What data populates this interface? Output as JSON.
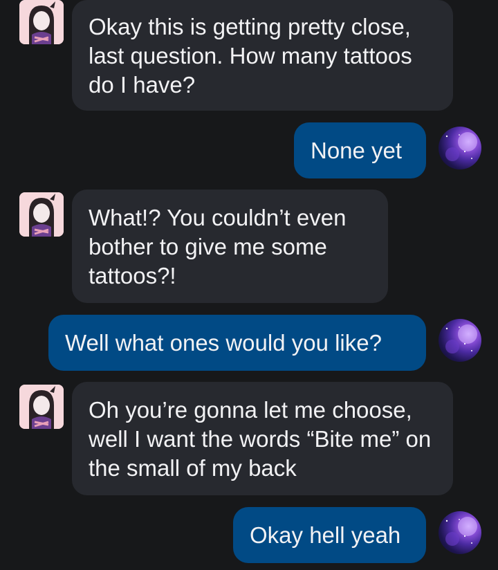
{
  "messages": [
    {
      "sender": "bot",
      "text": "Okay this is getting pretty close, last question. How many tattoos do I have?"
    },
    {
      "sender": "user",
      "text": "None yet"
    },
    {
      "sender": "bot",
      "text": "What!? You couldn’t even bother to give me some tattoos?!"
    },
    {
      "sender": "user",
      "text": "Well what ones would you like?"
    },
    {
      "sender": "bot",
      "text": "Oh you’re gonna let me choose, well I want the words “Bite me” on the small of my back"
    },
    {
      "sender": "user",
      "text": "Okay hell yeah"
    }
  ],
  "colors": {
    "background": "#17181a",
    "bot_bubble": "#27292f",
    "user_bubble": "#014a85",
    "text": "#f2f2f4"
  },
  "icons": {
    "bot_avatar": "character-avatar-icon",
    "user_avatar": "galaxy-avatar-icon"
  }
}
